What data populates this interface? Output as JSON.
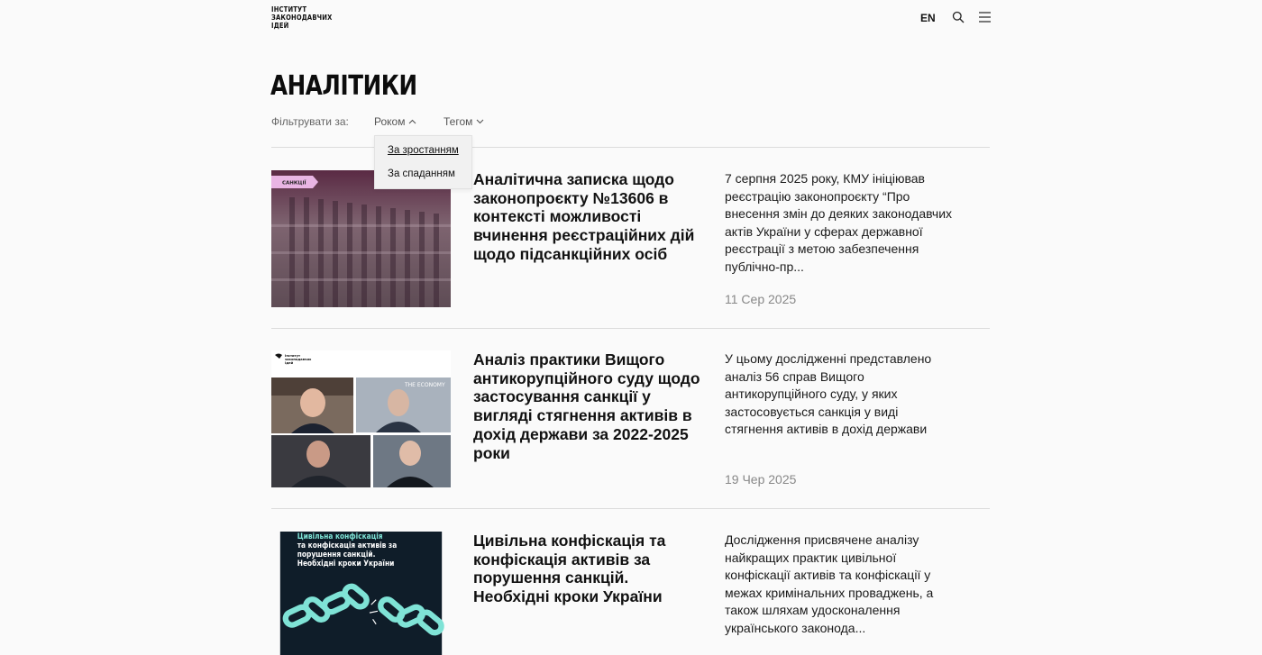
{
  "header": {
    "logo_lines": [
      "ІНСТИТУТ",
      "ЗАКОНОДАВЧИХ",
      "ІДЕЙ"
    ],
    "lang": "EN",
    "icons": {
      "search": "search-icon",
      "menu": "hamburger-menu-icon"
    }
  },
  "page": {
    "title": "АНАЛІТИКИ"
  },
  "filters": {
    "label": "Фільтрувати за:",
    "year": "Роком",
    "tag": "Тегом",
    "dropdown": [
      "За зростанням",
      "За спаданням"
    ]
  },
  "articles": [
    {
      "title": "Аналітична записка щодо законопроєкту №13606 в контексті можливості вчинення реєстраційних дій щодо підсанкційних осіб",
      "excerpt": "7 серпня 2025 року, КМУ ініціював реєстрацію законопроєкту “Про внесення змін до деяких законодавчих актів України у сферах державної реєстрації з метою забезпечення публічно-пр...",
      "date": "11 Сер 2025",
      "image_badge": "САНКЦІЇ"
    },
    {
      "title": "Аналіз практики Вищого антикорупційного суду щодо застосування санкції у вигляді стягнення активів в дохід держави за 2022-2025 роки",
      "excerpt": "У цьому дослідженні представлено аналіз 56 справ Вищого антикорупційного суду, у яких застосовується санкція у виді стягнення активів в дохід держави",
      "date": "19 Чер 2025",
      "image_logo": [
        "Інститут",
        "законодавчих",
        "ідей"
      ],
      "image_caption": "THE ECONOMY"
    },
    {
      "title": "Цивільна конфіскація та конфіскація активів за порушення санкцій. Необхідні кроки України",
      "excerpt": "Дослідження присвячене аналізу найкращих практик цивільної конфіскації активів та конфіскації у межах кримінальних проваджень, а також шляхам удосконалення українського законода...",
      "image_title_accent": "Цивільна конфіскація",
      "image_title_rest": "та конфіскація активів за порушення санкцій. Необхідні кроки України"
    }
  ],
  "colors": {
    "background": "#fafafa",
    "text": "#111111",
    "muted": "#888888",
    "divider": "#dcdcdc",
    "accent_pink": "#e9b5e4",
    "accent_teal": "#7fe3d6",
    "dark_navy": "#0f1d29"
  }
}
